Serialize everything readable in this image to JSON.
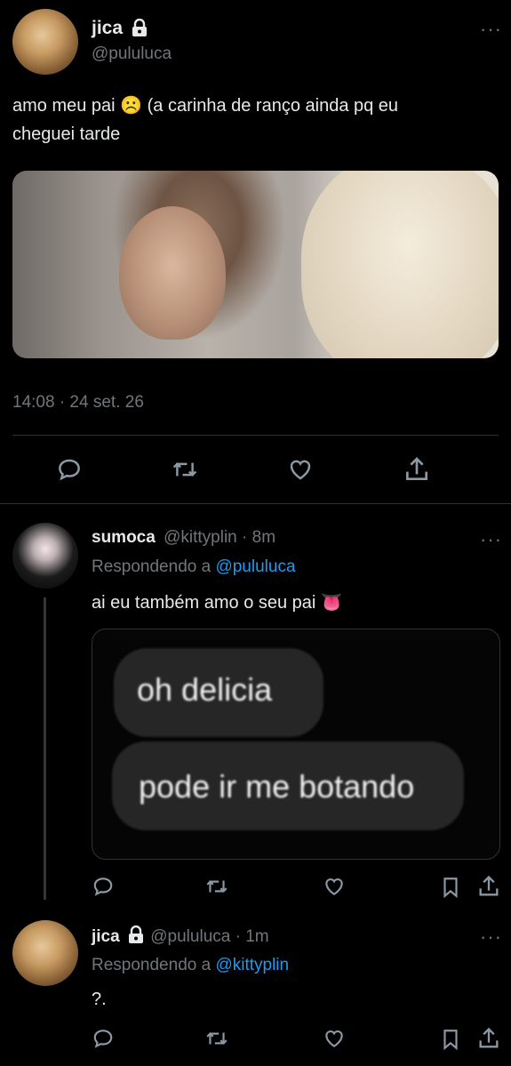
{
  "main_tweet": {
    "display_name": "jica",
    "handle": "@pululuca",
    "text_line1": "amo meu pai ☹️ (a carinha de ranço ainda pq eu",
    "text_line2": "cheguei tarde",
    "timestamp": "14:08 · 24 set. 26"
  },
  "reply1": {
    "display_name": "sumoca",
    "handle_time": "@kittyplin · 8m",
    "replying_prefix": "Respondendo a ",
    "replying_to": "@pululuca",
    "text": "ai eu também amo o seu pai 👅",
    "media_line1": "oh delicia",
    "media_line2": "pode ir me botando"
  },
  "reply2": {
    "display_name": "jica",
    "handle_time": "@pululuca · 1m",
    "replying_prefix": "Respondendo a ",
    "replying_to": "@kittyplin",
    "text": "?."
  },
  "icons": {
    "reply": "reply-icon",
    "retweet": "retweet-icon",
    "like": "like-icon",
    "share": "share-icon",
    "bookmark": "bookmark-icon",
    "lock": "lock-icon",
    "more": "more-icon"
  },
  "colors": {
    "background": "#000000",
    "text": "#e7e9ea",
    "muted": "#71767b",
    "link": "#1d9bf0"
  }
}
